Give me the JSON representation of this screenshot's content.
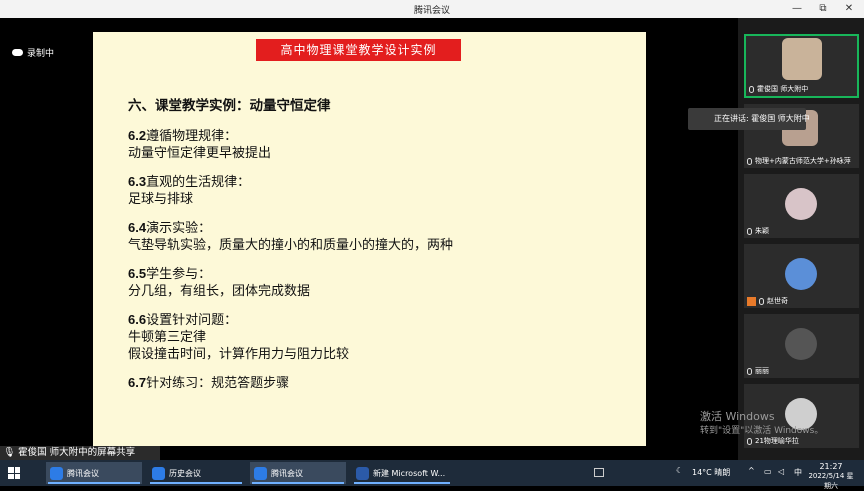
{
  "window": {
    "title": "腾讯会议",
    "controls": [
      "—",
      "⧉",
      "✕"
    ]
  },
  "recording": {
    "label": "录制中"
  },
  "slide": {
    "title": "高中物理课堂教学设计实例",
    "heading": "六、课堂教学实例：动量守恒定律",
    "sections": [
      {
        "num": "6.2",
        "title": "遵循物理规律：",
        "lines": [
          "动量守恒定律更早被提出"
        ]
      },
      {
        "num": "6.3",
        "title": "直观的生活规律：",
        "lines": [
          "足球与排球"
        ]
      },
      {
        "num": "6.4",
        "title": "演示实验：",
        "lines": [
          "气垫导轨实验，质量大的撞小的和质量小的撞大的，两种"
        ]
      },
      {
        "num": "6.5",
        "title": "学生参与：",
        "lines": [
          "分几组，有组长，团体完成数据"
        ]
      },
      {
        "num": "6.6",
        "title": "设置针对问题：",
        "lines": [
          "牛顿第三定律",
          "假设撞击时间，计算作用力与阻力比较"
        ]
      },
      {
        "num": "6.7",
        "title": "针对练习：规范答题步骤",
        "lines": []
      }
    ]
  },
  "share_bar": {
    "text": "霍俊国  师大附中的屏幕共享"
  },
  "speaking": {
    "text": "正在讲话: 霍俊国  师大附中"
  },
  "participants": [
    {
      "name": "霍俊国  师大附中",
      "icon": "mic-icon",
      "avatar": "#c9b39a"
    },
    {
      "name": "物理+内蒙古师范大学+孙咏萍",
      "icon": "mic-muted-icon",
      "avatar": "#b8a090"
    },
    {
      "name": "朱颖",
      "icon": "mic-muted-icon",
      "avatar": "#d8c4c8"
    },
    {
      "name": "赵世奇",
      "icon": "mic-muted-icon",
      "avatar": "#5b8fd8"
    },
    {
      "name": "丽丽",
      "icon": "mic-muted-icon",
      "avatar": "#555555"
    },
    {
      "name": "21物理喻华拉",
      "icon": "mic-muted-icon",
      "avatar": "#cfcfcf"
    }
  ],
  "watermark": {
    "line1": "激活 Windows",
    "line2": "转到\"设置\"以激活 Windows。"
  },
  "taskbar": {
    "items": [
      {
        "label": "腾讯会议"
      },
      {
        "label": "历史会议"
      },
      {
        "label": "腾讯会议"
      },
      {
        "label": "新建 Microsoft W..."
      }
    ],
    "weather": "14°C  晴朗",
    "time": "21:27",
    "date": "2022/5/14 星期六",
    "lang": "中"
  },
  "colors": {
    "accent_green": "#18b65a",
    "slide_bg": "#fdf9d8",
    "title_red": "#e31e1e"
  }
}
